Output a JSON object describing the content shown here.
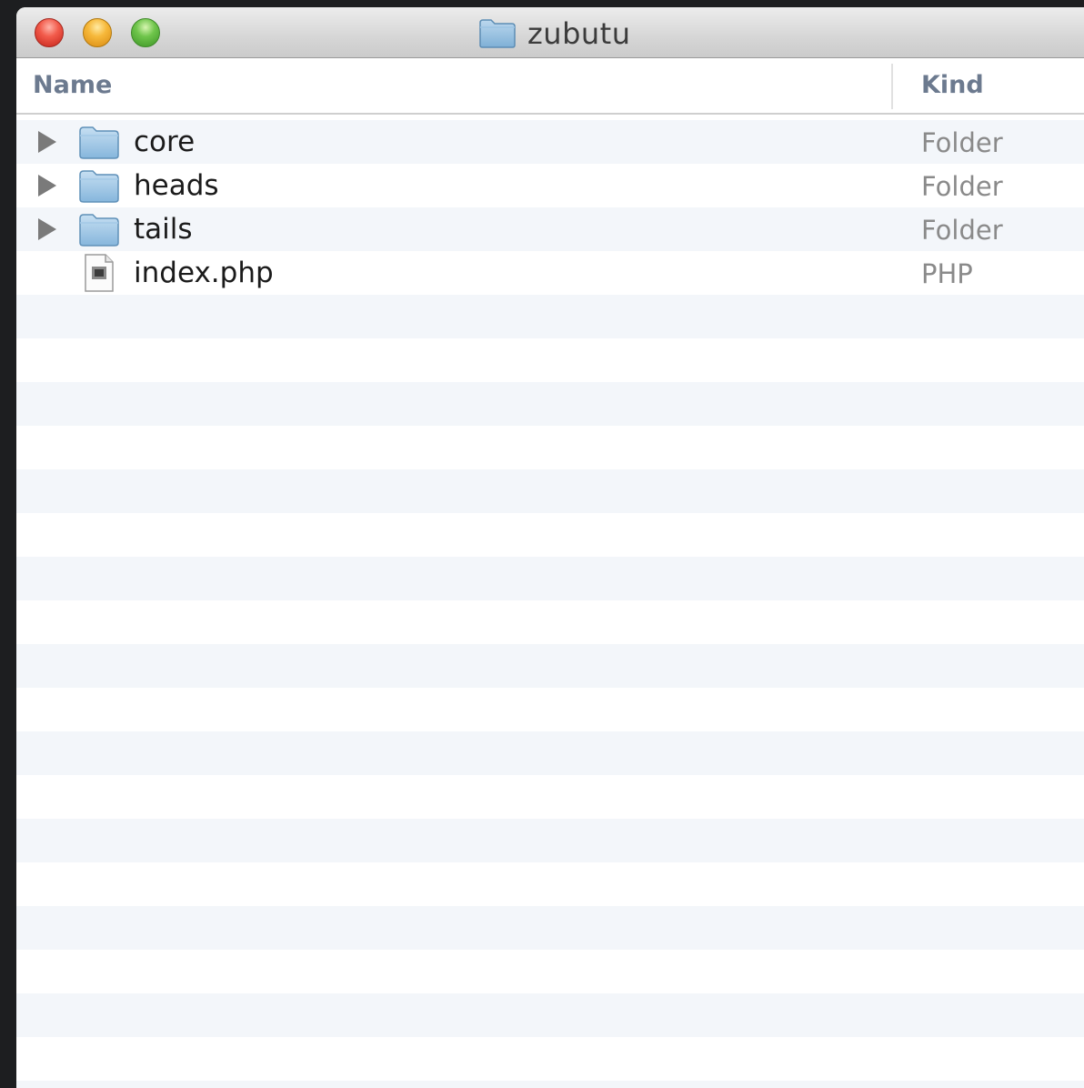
{
  "window": {
    "title": "zubutu",
    "title_icon": "folder-icon"
  },
  "columns": {
    "name": "Name",
    "kind": "Kind"
  },
  "rows": [
    {
      "name": "core",
      "kind": "Folder",
      "icon": "folder-icon",
      "expandable": true
    },
    {
      "name": "heads",
      "kind": "Folder",
      "icon": "folder-icon",
      "expandable": true
    },
    {
      "name": "tails",
      "kind": "Folder",
      "icon": "folder-icon",
      "expandable": true
    },
    {
      "name": "index.php",
      "kind": "PHP",
      "icon": "php-file-icon",
      "expandable": false
    }
  ],
  "colors": {
    "stripe": "#f3f6fa",
    "header_text": "#6c7a8f",
    "kind_text": "#8a8a8a"
  }
}
